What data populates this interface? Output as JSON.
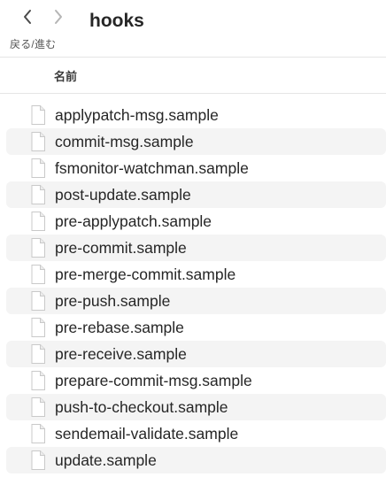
{
  "toolbar": {
    "nav_label": "戻る/進む",
    "title": "hooks",
    "back_icon": "chevron-left-icon",
    "forward_icon": "chevron-right-icon"
  },
  "columns": {
    "name": "名前"
  },
  "files": [
    "applypatch-msg.sample",
    "commit-msg.sample",
    "fsmonitor-watchman.sample",
    "post-update.sample",
    "pre-applypatch.sample",
    "pre-commit.sample",
    "pre-merge-commit.sample",
    "pre-push.sample",
    "pre-rebase.sample",
    "pre-receive.sample",
    "prepare-commit-msg.sample",
    "push-to-checkout.sample",
    "sendemail-validate.sample",
    "update.sample"
  ],
  "colors": {
    "stripe": "#f4f4f4",
    "text": "#262626"
  }
}
